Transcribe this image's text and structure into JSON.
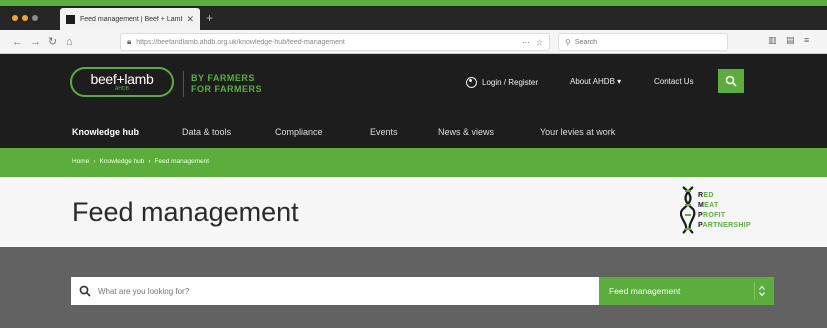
{
  "browser": {
    "tab_title": "Feed management | Beef + Lamb",
    "url_path": "https://beefandlamb.ahdb.org.uk/knowledge-hub/feed-management",
    "search_placeholder": "Search",
    "new_tab_glyph": "+"
  },
  "header": {
    "logo_word": "beef+lamb",
    "logo_sub": "AHDB",
    "tagline_line1": "BY FARMERS",
    "tagline_line2": "FOR FARMERS",
    "login_label": "Login / Register",
    "about_label": "About AHDB",
    "contact_label": "Contact Us"
  },
  "nav": {
    "items": [
      {
        "label": "Knowledge hub"
      },
      {
        "label": "Data & tools"
      },
      {
        "label": "Compliance"
      },
      {
        "label": "Events"
      },
      {
        "label": "News & views"
      },
      {
        "label": "Your levies at work"
      }
    ]
  },
  "breadcrumb": [
    "Home",
    "Knowledge hub",
    "Feed management"
  ],
  "page": {
    "title": "Feed management"
  },
  "partner": {
    "lines": [
      {
        "cap": "R",
        "rest": "ED"
      },
      {
        "cap": "M",
        "rest": "EAT"
      },
      {
        "cap": "P",
        "rest": "ROFIT"
      },
      {
        "cap": "P",
        "rest": "ARTNERSHIP"
      }
    ]
  },
  "search": {
    "placeholder": "What are you looking for?",
    "topic_selected": "Feed management"
  },
  "colors": {
    "brand_green": "#5bae3c",
    "header_dark": "#1d1d1d",
    "search_band": "#626262"
  }
}
